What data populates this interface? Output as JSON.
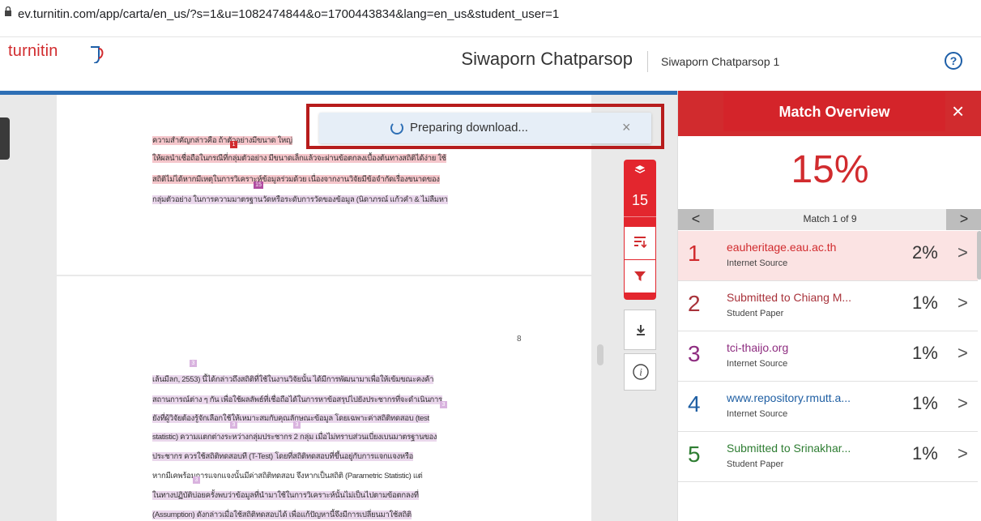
{
  "browser": {
    "url": "ev.turnitin.com/app/carta/en_us/?s=1&u=1082474844&o=1700443834&lang=en_us&student_user=1"
  },
  "header": {
    "logo": "turnitin",
    "title": "Siwaporn Chatparsop",
    "subtitle": "Siwaporn Chatparsop 1",
    "help_label": "?"
  },
  "toast": {
    "message": "Preparing download...",
    "close": "×"
  },
  "toolbar": {
    "match_count": "15"
  },
  "document": {
    "page1_lines": [
      "ความสำคัญกล่าวคือ ถ้าตัวอย่างมีขนาด ใหญ่",
      "ให้ผลนำเชื่อถือในกรณีที่กลุ่มตัวอย่าง มีขนาดเล็กแล้วจะผ่านข้อตกลงเบื้องต้นทางสถิติได้ง่าย ใช้",
      "สถิติไม่ได้หากมีเหตุในการวิเคราะห์ข้อมูลร่วมด้วย เนื่องจากงานวิจัยมีข้อจำกัดเรื่องขนาดของ",
      "กลุ่มตัวอย่าง ในการความมาตรฐานวัดหรือระดับการวัดของข้อมูล (นิดาภรณ์ แก้วคำ & ไม่ลืมหา"
    ],
    "page_number": "8",
    "page2_lines": [
      "เล้นมีลก, 2553) นี้ได้กล่าวถึงสถิติที่ใช้ในงานวิจัยนั้น ได้มีการพัฒนามาเพื่อให้เข้มขณะคงค้า",
      "สถานการณ์ต่าง ๆ กัน เพื่อใช้ผลลัพธ์ที่เชื่อถือได้ในการหาข้อสรุปไปยังประชากรที่จะดำเนินการ",
      "ยังที่ผู้วิจัยต้องรู้จักเลือกใช้ให้เหมาะสมกับคุณลักษณะข้อมูล โดยเฉพาะค่าสถิติทดสอบ (test",
      "statistic) ความแตกต่างระหว่างกลุ่มประชากร 2 กลุ่ม เมื่อไม่ทราบส่วนเบี่ยงเบนมาตรฐานของ",
      "ประชากร ควรใช้สถิติทดสอบที (T-Test) โดยที่สถิติทดสอบที่ขึ้นอยู่กับการแจกแจงหรือ",
      "หากมีเคพร้อมการแจกแจงนั้นมีค่าสถิติทดสอบ จึงหากเป็นสถิติ (Parametric Statistic) แต่",
      "ในทางปฏิบัติบ่อยครั้งพบว่าข้อมูลที่นำมาใช้ในการวิเคราะห์นั้นไม่เป็นไปตามข้อตกลงที่",
      "(Assumption) ดังกล่าวเมื่อใช้สถิติทดสอบได้ เพื่อแก้ปัญหานี้จึงมีการเปลี่ยนมาใช้สถิติ"
    ],
    "markers": [
      "1",
      "15",
      "3",
      "3",
      "3",
      "3",
      "3"
    ]
  },
  "panel": {
    "title": "Match Overview",
    "close": "×",
    "similarity": "15%",
    "nav_prev": "<",
    "nav_next": ">",
    "match_label": "Match 1 of 9",
    "matches": [
      {
        "num": "1",
        "source": "eauheritage.eau.ac.th",
        "type": "Internet Source",
        "pct": "2%",
        "color": "#d12b2e"
      },
      {
        "num": "2",
        "source": "Submitted to Chiang M...",
        "type": "Student Paper",
        "pct": "1%",
        "color": "#a8323a"
      },
      {
        "num": "3",
        "source": "tci-thaijo.org",
        "type": "Internet Source",
        "pct": "1%",
        "color": "#8e2d80"
      },
      {
        "num": "4",
        "source": "www.repository.rmutt.a...",
        "type": "Internet Source",
        "pct": "1%",
        "color": "#1f5fa3"
      },
      {
        "num": "5",
        "source": "Submitted to Srinakhar...",
        "type": "Student Paper",
        "pct": "1%",
        "color": "#2e7d32"
      }
    ]
  },
  "colors": {
    "brand_red": "#d12b2e",
    "blue_accent": "#2e6fb5",
    "highlight_pink": "#f5c6cb",
    "highlight_purple": "#ead7ec"
  }
}
